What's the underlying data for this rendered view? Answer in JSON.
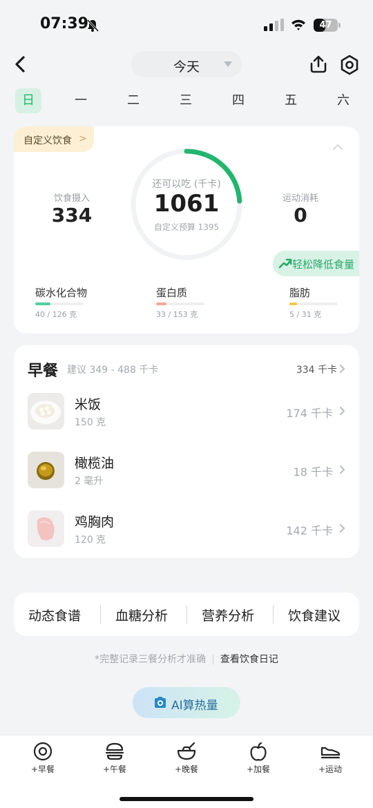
{
  "status_bar": {
    "time": "07:39",
    "battery": "47"
  },
  "header": {
    "date_label": "今天"
  },
  "week": [
    {
      "label": "日",
      "active": true
    },
    {
      "label": "一"
    },
    {
      "label": "二"
    },
    {
      "label": "三"
    },
    {
      "label": "四"
    },
    {
      "label": "五"
    },
    {
      "label": "六"
    }
  ],
  "summary": {
    "custom_tag": "自定义饮食",
    "intake_label": "饮食摄入",
    "intake_value": "334",
    "remaining_label": "还可以吃 (千卡)",
    "remaining_value": "1061",
    "budget_text": "自定义预算 1395",
    "exercise_label": "运动消耗",
    "exercise_value": "0",
    "ring_progress": 0.24,
    "reduce_label": "轻松降低食量",
    "macros": [
      {
        "name": "碳水化合物",
        "value": "40 / 126 克",
        "fraction": 0.317,
        "color": "#4fcf9a"
      },
      {
        "name": "蛋白质",
        "value": "33 / 153 克",
        "fraction": 0.216,
        "color": "#f4a596"
      },
      {
        "name": "脂肪",
        "value": "5 / 31 克",
        "fraction": 0.161,
        "color": "#f5c83a"
      }
    ]
  },
  "breakfast": {
    "title": "早餐",
    "range": "建议 349 - 488 千卡",
    "total": "334 千卡",
    "items": [
      {
        "name": "米饭",
        "amount": "150 克",
        "kcal": "174 千卡"
      },
      {
        "name": "橄榄油",
        "amount": "2 毫升",
        "kcal": "18 千卡"
      },
      {
        "name": "鸡胸肉",
        "amount": "120 克",
        "kcal": "142 千卡"
      }
    ]
  },
  "analysis_tabs": [
    "动态食谱",
    "血糖分析",
    "营养分析",
    "饮食建议"
  ],
  "note": {
    "text": "*完整记录三餐分析才准确",
    "link": "查看饮食日记"
  },
  "ai_button": "AI算热量",
  "bottom_nav": [
    "+早餐",
    "+午餐",
    "+晚餐",
    "+加餐",
    "+运动"
  ],
  "colors": {
    "accent": "#23b56e",
    "ring_track": "#f1f2f4"
  }
}
